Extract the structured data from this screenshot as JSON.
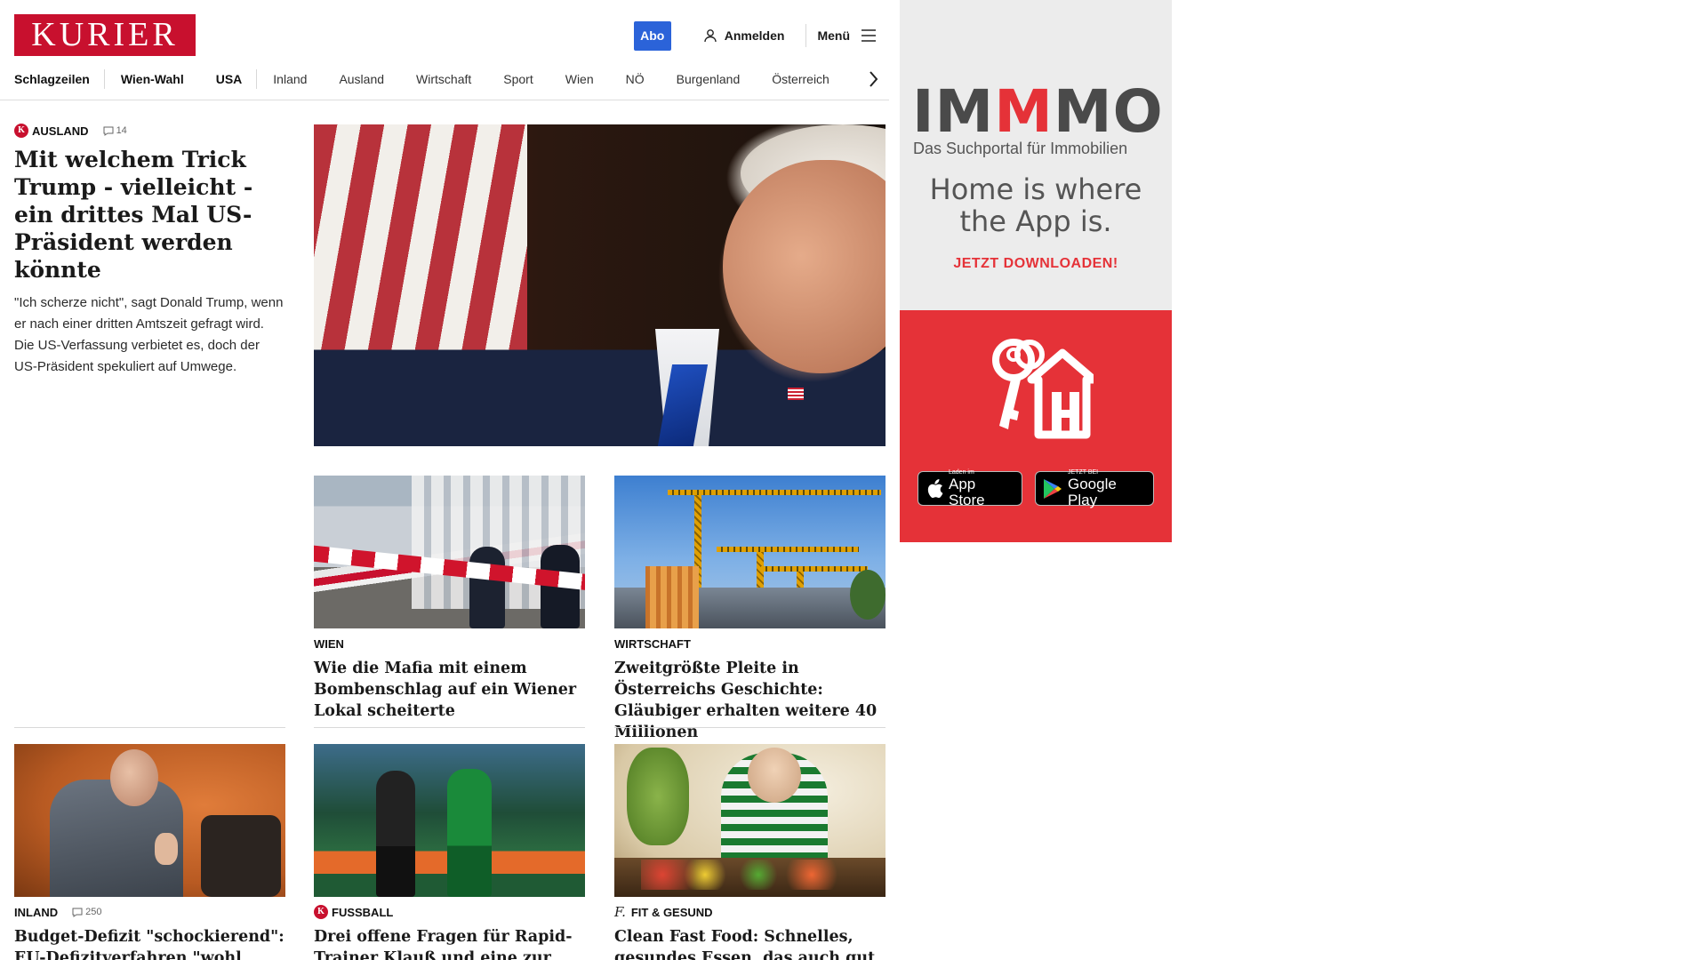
{
  "header": {
    "logo_text": "KURIER",
    "abo_label": "Abo",
    "login_label": "Anmelden",
    "menu_label": "Menü"
  },
  "nav": {
    "items": [
      "Schlagzeilen",
      "Wien-Wahl",
      "USA",
      "Inland",
      "Ausland",
      "Wirtschaft",
      "Sport",
      "Wien",
      "NÖ",
      "Burgenland",
      "Österreich"
    ]
  },
  "hero": {
    "category": "AUSLAND",
    "comments": "14",
    "title": "Mit welchem Trick Trump - vielleicht - ein drittes Mal US-Präsident werden könnte",
    "teaser": "\"Ich scherze nicht\", sagt Donald Trump, wenn er nach einer dritten Amtszeit gefragt wird. Die US-Verfassung verbietet es, doch der US-Präsident spekuliert auf Umwege."
  },
  "cards": [
    {
      "category": "WIEN",
      "title": "Wie die Mafia mit einem Bombenschlag auf ein Wiener Lokal scheiterte"
    },
    {
      "category": "WIRTSCHAFT",
      "title": "Zweitgrößte Pleite in Österreichs Geschichte: Gläubiger erhalten weitere 40 Millionen"
    },
    {
      "category": "INLAND",
      "comments": "250",
      "title": "Budget-Defizit \"schockierend\": EU-Defizitverfahren \"wohl unausweichlich\""
    },
    {
      "category": "FUSSBALL",
      "title": "Drei offene Fragen für Rapid-Trainer Klauß und eine zur Grgic-Sperre"
    },
    {
      "category": "FIT & GESUND",
      "title": "Clean Fast Food: Schnelles, gesundes Essen, das auch gut schmeckt"
    }
  ],
  "ad": {
    "brand_pre": "IM",
    "brand_m": "M",
    "brand_post": "MO",
    "subtitle": "Das Suchportal für Immobilien",
    "slogan_1": "Home is where",
    "slogan_2": "the App is.",
    "cta": "JETZT DOWNLOADEN!",
    "appstore_small": "Laden im",
    "appstore_big": "App Store",
    "googleplay_small": "JETZT BEI",
    "googleplay_big": "Google Play"
  },
  "colors": {
    "brand_red": "#c8102e",
    "abo_blue": "#2b63d9",
    "ad_red": "#e53238"
  },
  "icons": [
    "user-icon",
    "menu-icon",
    "chevron-right-icon",
    "comment-icon",
    "kurier-k-icon",
    "apple-icon",
    "google-play-icon",
    "keys-house-icon"
  ]
}
